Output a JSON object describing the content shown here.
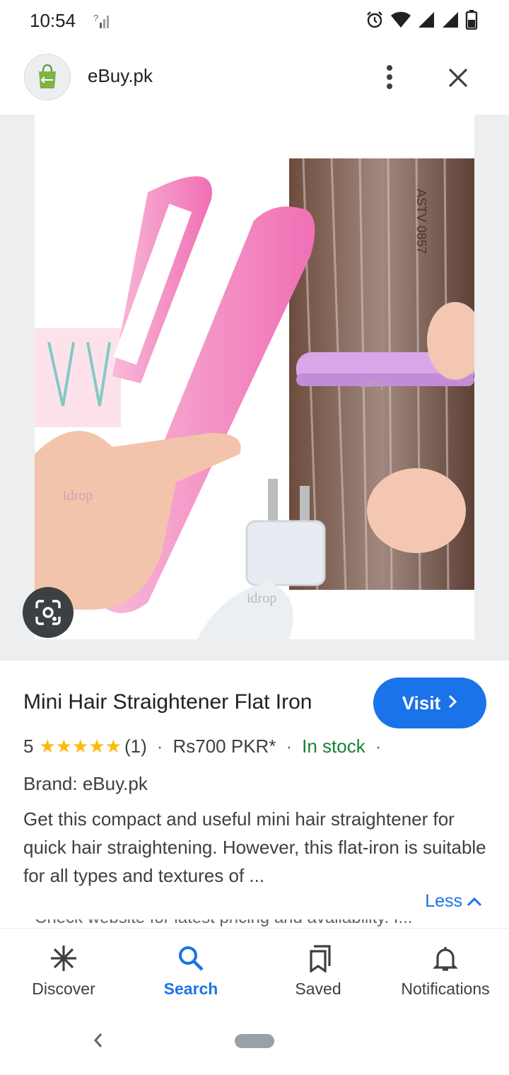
{
  "status_bar": {
    "time": "10:54",
    "icons": [
      "network-unknown-icon",
      "alarm-icon",
      "wifi-icon",
      "signal-icon",
      "signal-icon",
      "battery-icon"
    ]
  },
  "header": {
    "site_name": "eBuy.pk",
    "logo_icon": "shopping-bag-icon",
    "more_icon": "more-vert-icon",
    "close_icon": "close-icon"
  },
  "image": {
    "watermark_code": "ASTV 0857",
    "brand_marks": [
      "idrop",
      "idrop",
      "idrop"
    ],
    "lens_icon": "google-lens-icon"
  },
  "product": {
    "title": "Mini Hair Straightener Flat Iron",
    "visit_label": "Visit",
    "rating_value": "5",
    "stars": "★★★★★",
    "review_count": "(1)",
    "separator": "·",
    "price": "Rs700 PKR*",
    "availability": "In stock",
    "brand_line": "Brand: eBuy.pk",
    "description": "Get this compact and useful mini hair straightener for quick hair straightening. However, this flat-iron is suitable for all types and textures of ...",
    "less_label": "Less",
    "clipped_line": "* Check website for latest pricing and availability. I..."
  },
  "bottom_nav": {
    "items": [
      {
        "label": "Discover",
        "icon": "asterisk-icon"
      },
      {
        "label": "Search",
        "icon": "search-icon"
      },
      {
        "label": "Saved",
        "icon": "saved-icon"
      },
      {
        "label": "Notifications",
        "icon": "bell-icon"
      }
    ],
    "active": "Search"
  },
  "colors": {
    "accent": "#1a73e8",
    "in_stock": "#188038",
    "stars": "#fbbc04",
    "product_pink": "#f2a9d4"
  }
}
